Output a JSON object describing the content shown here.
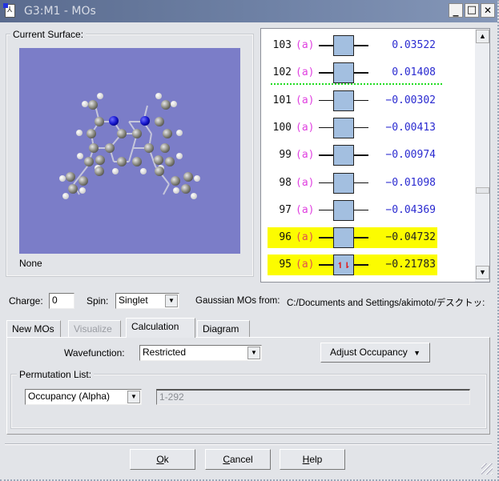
{
  "window": {
    "title": "G3:M1 - MOs",
    "controls": {
      "minimize": "_",
      "maximize": "□",
      "close": "✕"
    }
  },
  "surface": {
    "group_label": "Current Surface:",
    "current": "None",
    "viewer_bg": "#7b7dc8"
  },
  "mo_list": {
    "rows": [
      {
        "index": "103",
        "symmetry": "(a)",
        "energy": "0.03522",
        "occupancy": "",
        "highlighted": false
      },
      {
        "index": "102",
        "symmetry": "(a)",
        "energy": "0.01408",
        "occupancy": "",
        "highlighted": false
      },
      {
        "index": "101",
        "symmetry": "(a)",
        "energy": "−0.00302",
        "occupancy": "",
        "highlighted": false
      },
      {
        "index": "100",
        "symmetry": "(a)",
        "energy": "−0.00413",
        "occupancy": "",
        "highlighted": false
      },
      {
        "index": "99",
        "symmetry": "(a)",
        "energy": "−0.00974",
        "occupancy": "",
        "highlighted": false
      },
      {
        "index": "98",
        "symmetry": "(a)",
        "energy": "−0.01098",
        "occupancy": "",
        "highlighted": false
      },
      {
        "index": "97",
        "symmetry": "(a)",
        "energy": "−0.04369",
        "occupancy": "",
        "highlighted": false
      },
      {
        "index": "96",
        "symmetry": "(a)",
        "energy": "−0.04732",
        "occupancy": "",
        "highlighted": true
      },
      {
        "index": "95",
        "symmetry": "(a)",
        "energy": "−0.21783",
        "occupancy": "↿⇂",
        "highlighted": true
      }
    ],
    "highlight_color": "#fcfc00",
    "homo_lumo_line_color": "#22dd22",
    "scroll_up": "▲",
    "scroll_down": "▼"
  },
  "settings": {
    "charge_label": "Charge:",
    "charge_value": "0",
    "spin_label": "Spin:",
    "spin_value": "Singlet",
    "source_label": "Gaussian MOs from:",
    "source_path": "C:/Documents and Settings/akimoto/デスクトッ:"
  },
  "tabs": [
    {
      "label": "New MOs",
      "state": "normal"
    },
    {
      "label": "Visualize",
      "state": "disabled"
    },
    {
      "label": "Calculation",
      "state": "active"
    },
    {
      "label": "Diagram",
      "state": "normal"
    }
  ],
  "calculation": {
    "wavefunction_label": "Wavefunction:",
    "wavefunction_value": "Restricted",
    "adjust_occupancy_label": "Adjust Occupancy",
    "permutation_group_label": "Permutation List:",
    "permutation_type": "Occupancy (Alpha)",
    "permutation_range": "1-292"
  },
  "footer": {
    "ok": {
      "mnemonic": "O",
      "rest": "k"
    },
    "cancel": {
      "mnemonic": "C",
      "rest": "ancel"
    },
    "help": {
      "mnemonic": "H",
      "rest": "elp"
    }
  },
  "dropdown_arrow": "▼"
}
